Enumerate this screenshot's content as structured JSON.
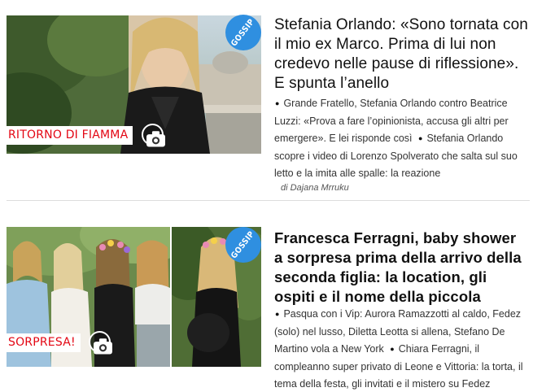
{
  "articles": [
    {
      "tag": "RITORNO DI FIAMMA",
      "badge": "GOSSIP",
      "title": "Stefania Orlando: «Sono tornata con il mio ex Marco. Prima di lui non credevo nelle pause di riflessione». E spunta l’anello",
      "related": [
        "Grande Fratello, Stefania Orlando contro Beatrice Luzzi: «Prova a fare l’opinionista, accusa gli altri per emergere». E lei risponde così",
        "Stefania Orlando scopre i video di Lorenzo Spolverato che salta sul suo letto e la imita alle spalle: la reazione"
      ],
      "author": "di Dajana Mrruku"
    },
    {
      "tag": "SORPRESA!",
      "badge": "GOSSIP",
      "title": "Francesca Ferragni, baby shower a sorpresa prima della arrivo della seconda figlia: la location, gli ospiti e il nome della piccola",
      "related": [
        "Pasqua con i Vip: Aurora Ramazzotti al caldo, Fedez (solo) nel lusso, Diletta Leotta si allena, Stefano De Martino vola a New York",
        "Chiara Ferragni, il compleanno super privato di Leone e Vittoria: la torta, il tema della festa, gli invitati e il mistero su Fedez"
      ]
    }
  ],
  "icons": {
    "camera": "camera-icon",
    "badge_color": "#2f8fe0",
    "tag_color": "#e30613"
  }
}
